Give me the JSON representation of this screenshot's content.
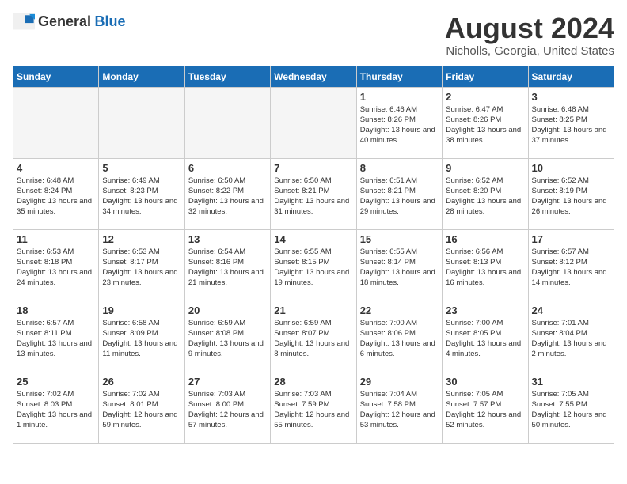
{
  "logo": {
    "text_general": "General",
    "text_blue": "Blue"
  },
  "title": "August 2024",
  "location": "Nicholls, Georgia, United States",
  "weekdays": [
    "Sunday",
    "Monday",
    "Tuesday",
    "Wednesday",
    "Thursday",
    "Friday",
    "Saturday"
  ],
  "weeks": [
    [
      {
        "day": "",
        "empty": true
      },
      {
        "day": "",
        "empty": true
      },
      {
        "day": "",
        "empty": true
      },
      {
        "day": "",
        "empty": true
      },
      {
        "day": "1",
        "sunrise": "6:46 AM",
        "sunset": "8:26 PM",
        "daylight": "13 hours and 40 minutes."
      },
      {
        "day": "2",
        "sunrise": "6:47 AM",
        "sunset": "8:26 PM",
        "daylight": "13 hours and 38 minutes."
      },
      {
        "day": "3",
        "sunrise": "6:48 AM",
        "sunset": "8:25 PM",
        "daylight": "13 hours and 37 minutes."
      }
    ],
    [
      {
        "day": "4",
        "sunrise": "6:48 AM",
        "sunset": "8:24 PM",
        "daylight": "13 hours and 35 minutes."
      },
      {
        "day": "5",
        "sunrise": "6:49 AM",
        "sunset": "8:23 PM",
        "daylight": "13 hours and 34 minutes."
      },
      {
        "day": "6",
        "sunrise": "6:50 AM",
        "sunset": "8:22 PM",
        "daylight": "13 hours and 32 minutes."
      },
      {
        "day": "7",
        "sunrise": "6:50 AM",
        "sunset": "8:21 PM",
        "daylight": "13 hours and 31 minutes."
      },
      {
        "day": "8",
        "sunrise": "6:51 AM",
        "sunset": "8:21 PM",
        "daylight": "13 hours and 29 minutes."
      },
      {
        "day": "9",
        "sunrise": "6:52 AM",
        "sunset": "8:20 PM",
        "daylight": "13 hours and 28 minutes."
      },
      {
        "day": "10",
        "sunrise": "6:52 AM",
        "sunset": "8:19 PM",
        "daylight": "13 hours and 26 minutes."
      }
    ],
    [
      {
        "day": "11",
        "sunrise": "6:53 AM",
        "sunset": "8:18 PM",
        "daylight": "13 hours and 24 minutes."
      },
      {
        "day": "12",
        "sunrise": "6:53 AM",
        "sunset": "8:17 PM",
        "daylight": "13 hours and 23 minutes."
      },
      {
        "day": "13",
        "sunrise": "6:54 AM",
        "sunset": "8:16 PM",
        "daylight": "13 hours and 21 minutes."
      },
      {
        "day": "14",
        "sunrise": "6:55 AM",
        "sunset": "8:15 PM",
        "daylight": "13 hours and 19 minutes."
      },
      {
        "day": "15",
        "sunrise": "6:55 AM",
        "sunset": "8:14 PM",
        "daylight": "13 hours and 18 minutes."
      },
      {
        "day": "16",
        "sunrise": "6:56 AM",
        "sunset": "8:13 PM",
        "daylight": "13 hours and 16 minutes."
      },
      {
        "day": "17",
        "sunrise": "6:57 AM",
        "sunset": "8:12 PM",
        "daylight": "13 hours and 14 minutes."
      }
    ],
    [
      {
        "day": "18",
        "sunrise": "6:57 AM",
        "sunset": "8:11 PM",
        "daylight": "13 hours and 13 minutes."
      },
      {
        "day": "19",
        "sunrise": "6:58 AM",
        "sunset": "8:09 PM",
        "daylight": "13 hours and 11 minutes."
      },
      {
        "day": "20",
        "sunrise": "6:59 AM",
        "sunset": "8:08 PM",
        "daylight": "13 hours and 9 minutes."
      },
      {
        "day": "21",
        "sunrise": "6:59 AM",
        "sunset": "8:07 PM",
        "daylight": "13 hours and 8 minutes."
      },
      {
        "day": "22",
        "sunrise": "7:00 AM",
        "sunset": "8:06 PM",
        "daylight": "13 hours and 6 minutes."
      },
      {
        "day": "23",
        "sunrise": "7:00 AM",
        "sunset": "8:05 PM",
        "daylight": "13 hours and 4 minutes."
      },
      {
        "day": "24",
        "sunrise": "7:01 AM",
        "sunset": "8:04 PM",
        "daylight": "13 hours and 2 minutes."
      }
    ],
    [
      {
        "day": "25",
        "sunrise": "7:02 AM",
        "sunset": "8:03 PM",
        "daylight": "13 hours and 1 minute."
      },
      {
        "day": "26",
        "sunrise": "7:02 AM",
        "sunset": "8:01 PM",
        "daylight": "12 hours and 59 minutes."
      },
      {
        "day": "27",
        "sunrise": "7:03 AM",
        "sunset": "8:00 PM",
        "daylight": "12 hours and 57 minutes."
      },
      {
        "day": "28",
        "sunrise": "7:03 AM",
        "sunset": "7:59 PM",
        "daylight": "12 hours and 55 minutes."
      },
      {
        "day": "29",
        "sunrise": "7:04 AM",
        "sunset": "7:58 PM",
        "daylight": "12 hours and 53 minutes."
      },
      {
        "day": "30",
        "sunrise": "7:05 AM",
        "sunset": "7:57 PM",
        "daylight": "12 hours and 52 minutes."
      },
      {
        "day": "31",
        "sunrise": "7:05 AM",
        "sunset": "7:55 PM",
        "daylight": "12 hours and 50 minutes."
      }
    ]
  ]
}
